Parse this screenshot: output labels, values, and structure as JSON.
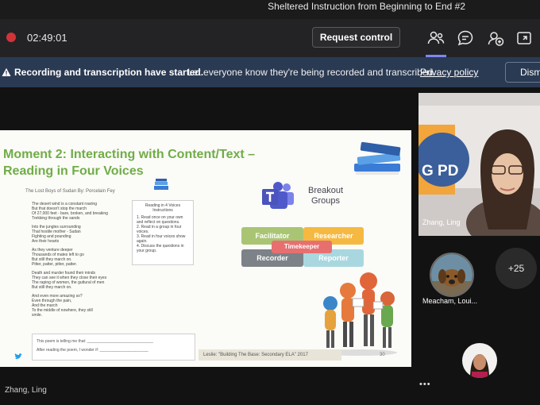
{
  "window": {
    "title": "Sheltered Instruction from Beginning to End #2"
  },
  "controls": {
    "timer": "02:49:01",
    "request_control": "Request control",
    "icons": [
      "people-icon",
      "chat-icon",
      "apps-icon",
      "share-icon"
    ]
  },
  "banner": {
    "bold": "Recording and transcription have started.",
    "message": "Let everyone know they're being recorded and transcribed.",
    "link": "Privacy policy",
    "dismiss": "Dismiss"
  },
  "slide": {
    "title_line1": "Moment 2: Interacting with Content/Text –",
    "title_line2": "Reading in Four Voices",
    "poem_heading": "The Lost Boys of Sudan  By: Porcelain Fey",
    "poem_lines": [
      "The desert wind is a constant roaring",
      "But that doesn't stop the march",
      "Of 27,000 feet - bare, broken, and breaking",
      "Trekking through the sands",
      "",
      "Into the jungles surrounding",
      "That hostile mother - Sudan",
      "Fighting and pounding",
      "Are their hearts",
      "",
      "As they venture deeper",
      "Thousands of mates left to go",
      "But still they march on.",
      "Pitter, patter, pitter, patter.",
      "",
      "Death and murder found their minds",
      "They can see it when they close their eyes",
      "The raping of women, the guttural of men",
      "But still they march on.",
      "",
      "And even more amazing so?",
      "Even through the pain,",
      "And the march",
      "To the middle of nowhere, they still",
      "smile."
    ],
    "steps_heading": "Reading in 4 Voices Instructions",
    "steps": [
      "1.  Read once on your own and reflect on questions.",
      "2.  Read in a group in four voices.",
      "3.  Read in four voices show again.",
      "4.  Discuss the questions in your group."
    ],
    "breakout_title": "Breakout Groups",
    "roles": {
      "facilitator": "Facilitator",
      "researcher": "Researcher",
      "timekeeper": "Timekeeper",
      "recorder": "Recorder",
      "reporter": "Reporter"
    },
    "bottom_lines": [
      "This poem is telling me that: ______________________________",
      "After reading the poem, I wonder if: ______________________"
    ],
    "citation": "Leslie: \"Building The Base: Secondary ELA\" 2017",
    "page_number": "30"
  },
  "participants": {
    "presenter_name": "Zhang, Ling",
    "presenter_bg_text": "G PD",
    "second_name": "Meacham, Loui...",
    "more_count": "+25",
    "overflow": "•••",
    "self_name": "Zhang, Ling"
  },
  "colors": {
    "accent": "#7f85f5",
    "slide_title": "#70ad47",
    "recording": "#d13438",
    "banner": "#2a3a53"
  }
}
